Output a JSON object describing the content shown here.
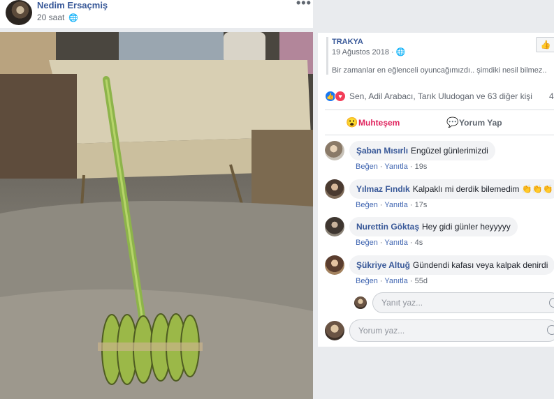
{
  "post": {
    "author": "Nedim Ersaçmiş",
    "time": "20 saat",
    "more": "•••"
  },
  "shared": {
    "name": "TRAKYA",
    "date": "19 Ağustos 2018",
    "text": "Bir zamanlar en eğlenceli oyuncağımızdı.. şimdiki nesil bilmez.."
  },
  "reactions": {
    "names": "Sen, Adil Arabacı, Tarık Uludogan ve 63 diğer kişi",
    "count": "4"
  },
  "actions": {
    "amazing_label": "Muhteşem",
    "comment_label": "Yorum Yap"
  },
  "comments": [
    {
      "name": "Şaban Mısırlı",
      "text": "Engüzel günlerimizdi",
      "like": "Beğen",
      "reply": "Yanıtla",
      "age": "19s"
    },
    {
      "name": "Yılmaz Fındık",
      "text": "Kalpaklı mi derdik bilemedim 👏👏👏",
      "like": "Beğen",
      "reply": "Yanıtla",
      "age": "17s"
    },
    {
      "name": "Nurettin Göktaş",
      "text": "Hey gidi günler heyyyyy",
      "like": "Beğen",
      "reply": "Yanıtla",
      "age": "4s"
    },
    {
      "name": "Şükriye Altuğ",
      "text": "Gündendi kafası veya kalpak denirdi",
      "like": "Beğen",
      "reply": "Yanıtla",
      "age": "55d"
    }
  ],
  "reply_input": {
    "placeholder": "Yanıt yaz..."
  },
  "comment_input": {
    "placeholder": "Yorum yaz..."
  },
  "colors": {
    "link": "#385898",
    "amazing": "#e0245e",
    "background": "#e9ebee"
  }
}
